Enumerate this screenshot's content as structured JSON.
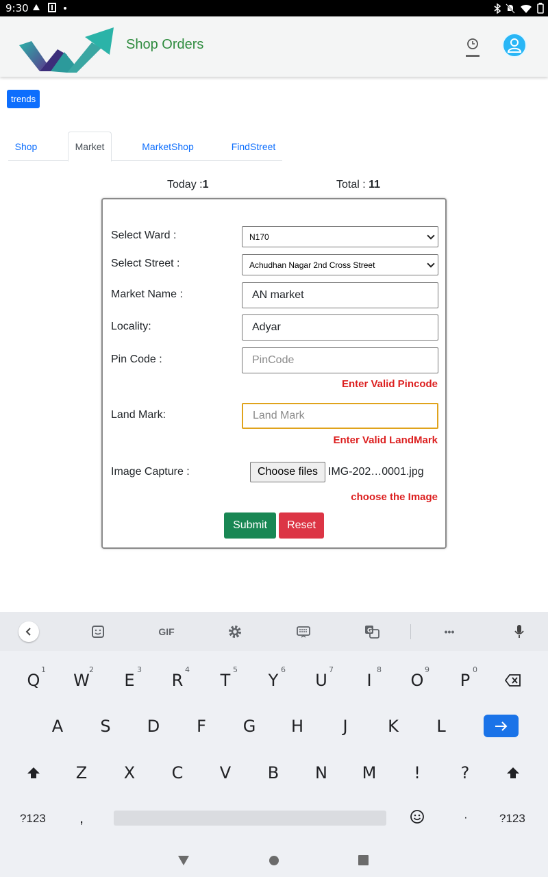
{
  "status_bar": {
    "time": "9:30"
  },
  "header": {
    "title": "Shop Orders"
  },
  "trends_label": "trends",
  "tabs": [
    {
      "label": "Shop"
    },
    {
      "label": "Market"
    },
    {
      "label": "MarketShop"
    },
    {
      "label": "FindStreet"
    }
  ],
  "counts": {
    "today_label": "Today :",
    "today_value": "1",
    "total_label": "Total : ",
    "total_value": "11"
  },
  "form": {
    "ward_label": "Select Ward :",
    "ward_value": "N170",
    "street_label": "Select Street :",
    "street_value": "Achudhan Nagar 2nd Cross Street",
    "market_label": "Market Name :",
    "market_value": "AN market",
    "locality_label": "Locality:",
    "locality_value": "Adyar",
    "pincode_label": "Pin Code :",
    "pincode_placeholder": "PinCode",
    "pincode_error": "Enter Valid Pincode",
    "landmark_label": "Land Mark:",
    "landmark_placeholder": "Land Mark",
    "landmark_error": "Enter Valid LandMark",
    "image_label": "Image Capture :",
    "choose_files_label": "Choose files",
    "file_name": "IMG-202…0001.jpg",
    "image_error": "choose the Image",
    "submit_label": "Submit",
    "reset_label": "Reset"
  },
  "keyboard": {
    "toolbar": {
      "gif_label": "GIF",
      "more_label": "•••"
    },
    "row1": [
      {
        "key": "Q",
        "hint": "1"
      },
      {
        "key": "W",
        "hint": "2"
      },
      {
        "key": "E",
        "hint": "3"
      },
      {
        "key": "R",
        "hint": "4"
      },
      {
        "key": "T",
        "hint": "5"
      },
      {
        "key": "Y",
        "hint": "6"
      },
      {
        "key": "U",
        "hint": "7"
      },
      {
        "key": "I",
        "hint": "8"
      },
      {
        "key": "O",
        "hint": "9"
      },
      {
        "key": "P",
        "hint": "0"
      }
    ],
    "row2": [
      "A",
      "S",
      "D",
      "F",
      "G",
      "H",
      "J",
      "K",
      "L"
    ],
    "row3": [
      "Z",
      "X",
      "C",
      "V",
      "B",
      "N",
      "M",
      "!",
      "?"
    ],
    "sym_label": "?123",
    "comma_label": ",",
    "period_label": "·",
    "sym_label_right": "?123"
  },
  "colors": {
    "accent_blue": "#0d6efd",
    "title_green": "#2e8b3e",
    "submit_green": "#198754",
    "reset_red": "#dc3545",
    "error_red": "#dc1f1f",
    "focus_orange": "#e0a31c"
  }
}
